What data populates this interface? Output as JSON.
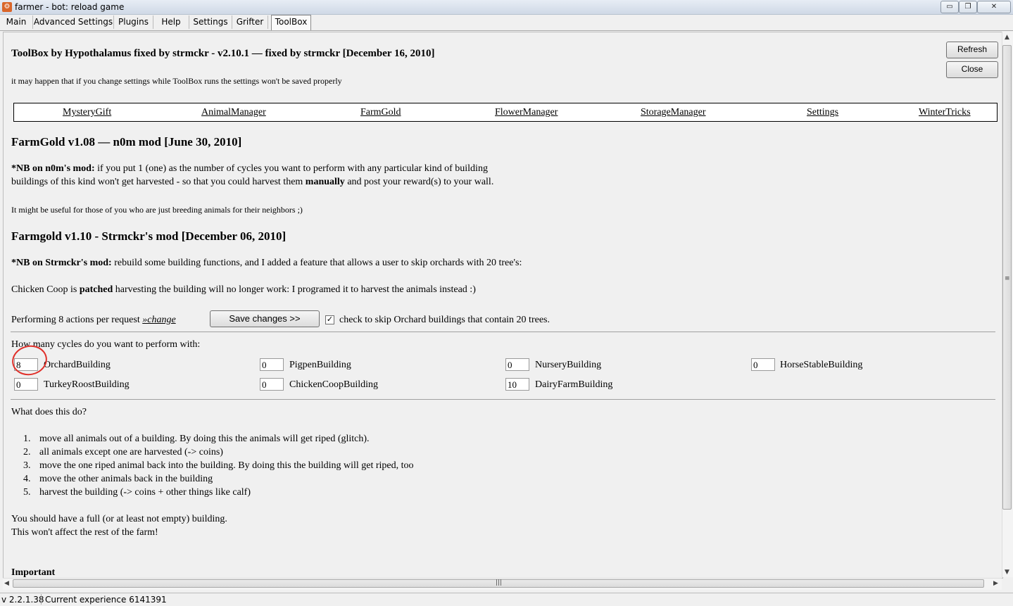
{
  "window": {
    "title": "farmer - bot: reload game",
    "controls": {
      "minimize": "▭",
      "maximize": "❐",
      "close": "✕"
    }
  },
  "tabs": [
    "Main",
    "Advanced Settings",
    "Plugins",
    "Help",
    "Settings",
    "Grifter",
    "ToolBox"
  ],
  "active_tab": "ToolBox",
  "toolbox": {
    "title": "ToolBox by Hypothalamus fixed by strmckr - v2.10.1 — fixed by strmckr [December 16, 2010]",
    "warning": "it may happen that if you change settings while ToolBox runs the settings won't be saved properly",
    "refresh_label": "Refresh",
    "close_label": "Close"
  },
  "nav": [
    "MysteryGift",
    "AnimalManager",
    "FarmGold",
    "FlowerManager",
    "StorageManager",
    "Settings",
    "WinterTricks"
  ],
  "farmgold": {
    "heading1": "FarmGold v1.08 — n0m mod [June 30, 2010]",
    "nb1_label": "*NB on n0m's mod:",
    "nb1_text": " if you put 1 (one) as the number of cycles you want to perform with any particular kind of building",
    "nb1_line2a": "buildings of this kind won't get harvested - so that you could harvest them ",
    "nb1_line2b": "manually",
    "nb1_line2c": " and post your reward(s) to your wall.",
    "note": "It might be useful for those of you who are just breeding animals for their neighbors ;)",
    "heading2": "Farmgold v1.10 - Strmckr's mod [December 06, 2010]",
    "nb2_label": "*NB on Strmckr's mod:",
    "nb2_text": " rebuild some building functions, and I added a feature that allows a user to skip orchards with 20 tree's:",
    "coop_a": "Chicken Coop is ",
    "coop_b": "patched",
    "coop_c": " harvesting the building will no longer work: I programed it to harvest the animals instead :)",
    "performing": "Performing 8 actions per request ",
    "change_link": "»change",
    "save_label": "Save changes >>",
    "skip_checked": true,
    "skip_check_mark": "✓",
    "skip_label": "check to skip Orchard buildings that contain 20 trees.",
    "cycles_question": "How many cycles do you want to perform with:",
    "buildings": [
      {
        "name": "OrchardBuilding",
        "value": "8"
      },
      {
        "name": "PigpenBuilding",
        "value": "0"
      },
      {
        "name": "NurseryBuilding",
        "value": "0"
      },
      {
        "name": "HorseStableBuilding",
        "value": "0"
      },
      {
        "name": "TurkeyRoostBuilding",
        "value": "0"
      },
      {
        "name": "ChickenCoopBuilding",
        "value": "0"
      },
      {
        "name": "DairyFarmBuilding",
        "value": "10"
      }
    ],
    "what_question": "What does this do?",
    "steps": [
      {
        "num": "1.",
        "text": "move all animals out of a building. By doing this the animals will get riped (glitch)."
      },
      {
        "num": "2.",
        "text": "all animals except one are harvested (-> coins)"
      },
      {
        "num": "3.",
        "text": "move the one riped animal back into the building. By doing this the building will get riped, too"
      },
      {
        "num": "4.",
        "text": "move the other animals back in the building"
      },
      {
        "num": "5.",
        "text": "harvest the building (-> coins + other things like calf)"
      }
    ],
    "full_line1": "You should have a full (or at least not empty) building.",
    "full_line2": "This won't affect the rest of the farm!",
    "important": "Important"
  },
  "scrollbars": {
    "up": "▲",
    "down": "▼",
    "left": "◀",
    "right": "▶",
    "grip_v": "≡",
    "grip_h": "|||"
  },
  "status": {
    "version": "v 2.2.1.38",
    "experience": "Current experience 6141391"
  }
}
